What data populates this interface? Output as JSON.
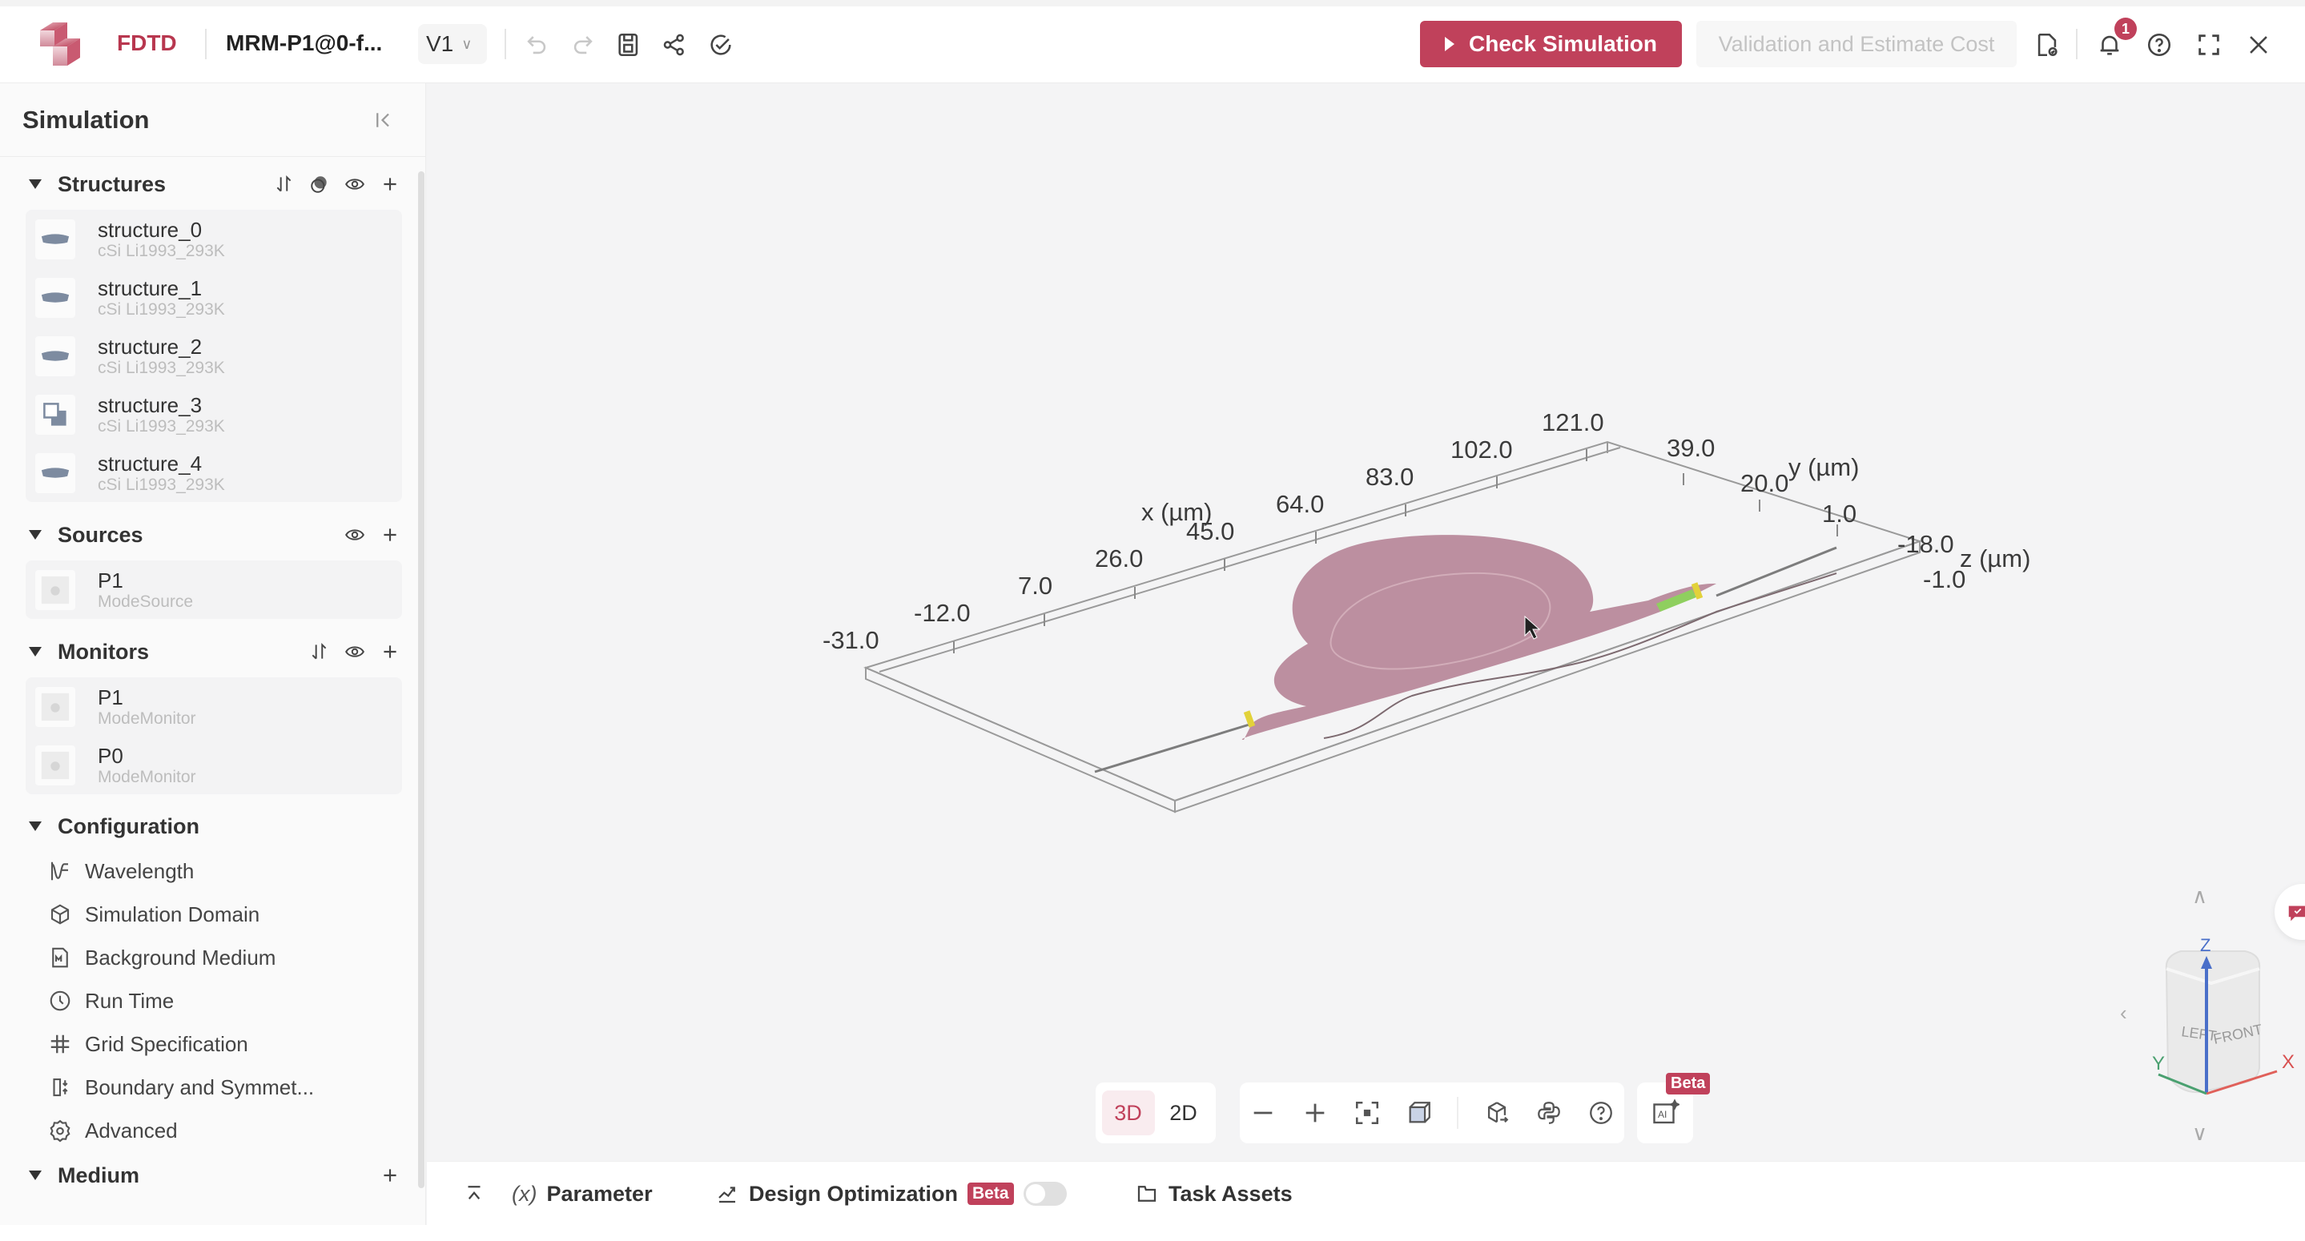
{
  "topbar": {
    "app_name": "FDTD",
    "project_name": "MRM-P1@0-f...",
    "version": "V1",
    "icons": [
      "undo-icon",
      "redo-icon",
      "save-icon",
      "share-icon",
      "check-circle-icon"
    ],
    "check_simulation_label": "Check Simulation",
    "validate_label": "Validation and Estimate Cost",
    "right_icons": [
      "file-check-icon",
      "bell-icon",
      "help-icon",
      "fullscreen-icon",
      "close-icon"
    ],
    "notification_count": "1",
    "accent_color": "#c0415b"
  },
  "sidebar": {
    "title": "Simulation",
    "structures": {
      "label": "Structures",
      "items": [
        {
          "name": "structure_0",
          "material": "cSi Li1993_293K"
        },
        {
          "name": "structure_1",
          "material": "cSi Li1993_293K"
        },
        {
          "name": "structure_2",
          "material": "cSi Li1993_293K"
        },
        {
          "name": "structure_3",
          "material": "cSi Li1993_293K"
        },
        {
          "name": "structure_4",
          "material": "cSi Li1993_293K"
        }
      ]
    },
    "sources": {
      "label": "Sources",
      "items": [
        {
          "name": "P1",
          "type": "ModeSource"
        }
      ]
    },
    "monitors": {
      "label": "Monitors",
      "items": [
        {
          "name": "P1",
          "type": "ModeMonitor"
        },
        {
          "name": "P0",
          "type": "ModeMonitor"
        }
      ]
    },
    "configuration": {
      "label": "Configuration",
      "items": [
        {
          "label": "Wavelength",
          "icon": "wavelength-icon"
        },
        {
          "label": "Simulation Domain",
          "icon": "cube-icon"
        },
        {
          "label": "Background Medium",
          "icon": "medium-file-icon"
        },
        {
          "label": "Run Time",
          "icon": "clock-icon"
        },
        {
          "label": "Grid Specification",
          "icon": "grid-icon"
        },
        {
          "label": "Boundary and Symmet...",
          "icon": "boundary-icon"
        },
        {
          "label": "Advanced",
          "icon": "gear-icon"
        }
      ]
    },
    "medium": {
      "label": "Medium"
    }
  },
  "viewport": {
    "axes": {
      "x_label": "x (µm)",
      "x_ticks": [
        "-31.0",
        "-12.0",
        "7.0",
        "26.0",
        "45.0",
        "64.0",
        "83.0",
        "102.0",
        "121.0"
      ],
      "y_label": "y (µm)",
      "y_ticks": [
        "39.0",
        "20.0",
        "1.0"
      ],
      "z_label": "z (µm)",
      "z_ticks": [
        "-18.0",
        "-1.0"
      ]
    },
    "structure_color": "#bc8fa0",
    "view_modes": [
      "3D",
      "2D"
    ],
    "active_view": "3D",
    "tools": [
      "zoom-out-icon",
      "zoom-in-icon",
      "fit-view-icon",
      "box-view-icon",
      "export-3d-icon",
      "python-icon",
      "help-icon"
    ],
    "ai_beta_label": "Beta",
    "viewcube": {
      "left": "LEFT",
      "front": "FRONT",
      "x": "X",
      "y": "Y",
      "z": "Z"
    }
  },
  "bottombar": {
    "parameter_label": "Parameter",
    "design_optimization_label": "Design Optimization",
    "beta_label": "Beta",
    "design_optimization_enabled": false,
    "task_assets_label": "Task Assets"
  }
}
